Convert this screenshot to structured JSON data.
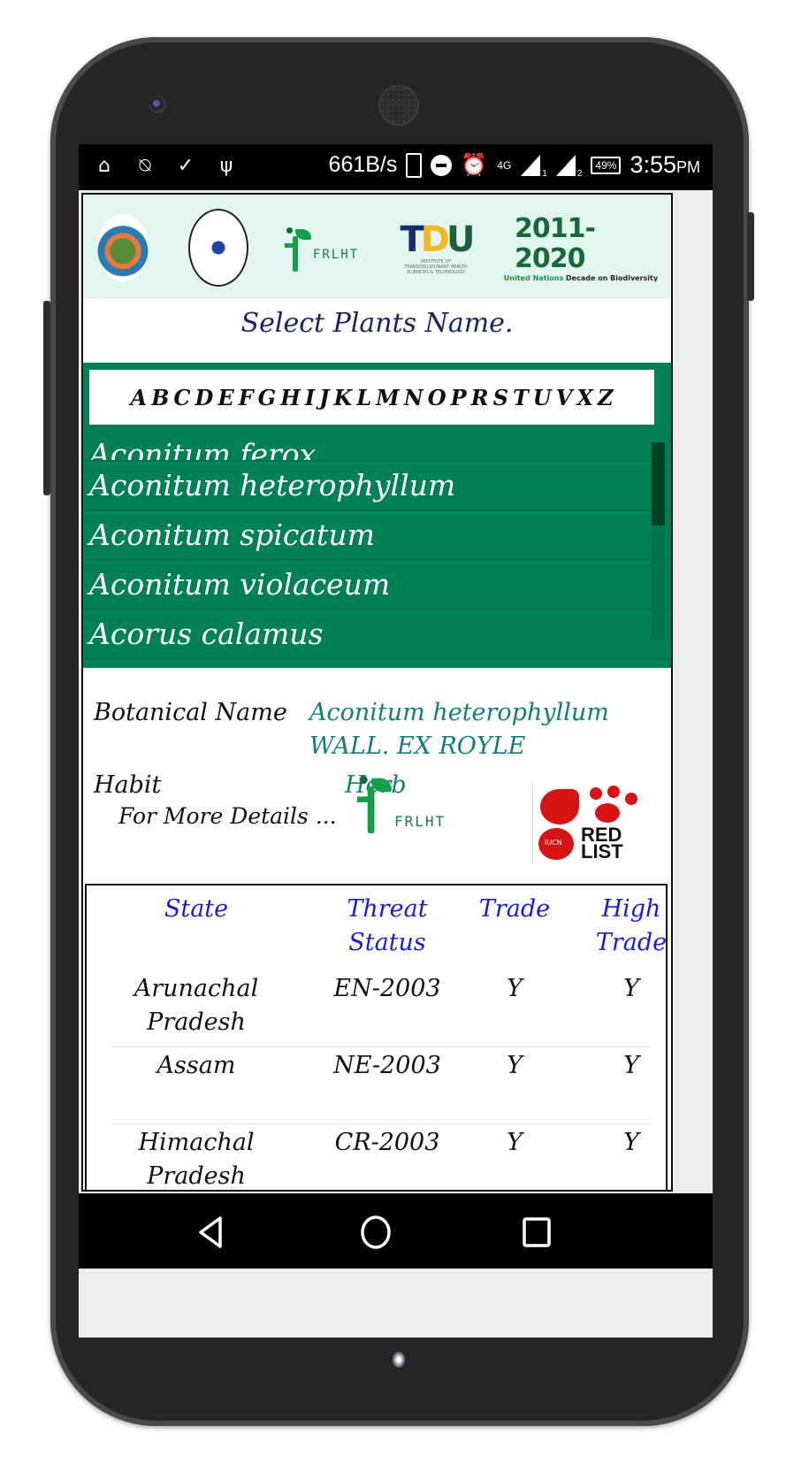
{
  "status_bar": {
    "left_icons": [
      "home-automation-icon",
      "notifications-off-icon",
      "task-check-icon",
      "usb-icon"
    ],
    "network_speed": "661B/s",
    "network_type": "4G",
    "sim1_label": "1",
    "sim2_label": "2",
    "battery": "49%",
    "time": "3:55",
    "ampm": "PM"
  },
  "logos": {
    "moef": "Ministry of Environment logo",
    "envis": "ENVIS - Working Towards a Sustainable Environment",
    "frlht": "FRLHT",
    "tdu": {
      "t": "T",
      "d": "D",
      "u": "U",
      "subtitle": "INSTITUTE OF TRANSDISCIPLINARY HEALTH SCIENCES & TECHNOLOGY"
    },
    "un": {
      "years": "2011-2020",
      "subtitle_un": "United Nations",
      "subtitle_rest": "Decade on Biodiversity"
    }
  },
  "page": {
    "title": "Select Plants Name."
  },
  "alphabet": [
    "A",
    "B",
    "C",
    "D",
    "E",
    "F",
    "G",
    "H",
    "I",
    "J",
    "K",
    "L",
    "M",
    "N",
    "O",
    "P",
    "R",
    "S",
    "T",
    "U",
    "V",
    "X",
    "Z"
  ],
  "plant_list": {
    "items": [
      "Aconitum ferox",
      "Aconitum heterophyllum",
      "Aconitum spicatum",
      "Aconitum violaceum",
      "Acorus calamus"
    ],
    "scroll_position": 0.2
  },
  "details": {
    "botanical_label": "Botanical Name",
    "botanical_value_line1": "Aconitum heterophyllum",
    "botanical_value_line2": "WALL. EX ROYLE",
    "habit_label": "Habit",
    "habit_value": "Herb",
    "more_details_label": "For More Details ...",
    "frlht_link": "FRLHT",
    "redlist_label_1": "RED",
    "redlist_label_2": "LIST"
  },
  "threat_table": {
    "headers": [
      "State",
      "Threat\nStatus",
      "Trade",
      "High\nTrade"
    ],
    "rows": [
      {
        "state": "Arunachal Pradesh",
        "status": "EN-2003",
        "trade": "Y",
        "high_trade": "Y"
      },
      {
        "state": "Assam",
        "status": "NE-2003",
        "trade": "Y",
        "high_trade": "Y"
      },
      {
        "state": "Himachal Pradesh",
        "status": "CR-2003",
        "trade": "Y",
        "high_trade": "Y"
      }
    ]
  },
  "nav_bar": {
    "back": "back-icon",
    "home": "home-icon",
    "recents": "recents-icon"
  },
  "colors": {
    "list_green": "#008055",
    "title_navy": "#17245e",
    "detail_teal": "#137c7c",
    "header_blue": "#1a1ae0",
    "logo_bg": "#e2f6ef",
    "redlist_red": "#d71313"
  }
}
